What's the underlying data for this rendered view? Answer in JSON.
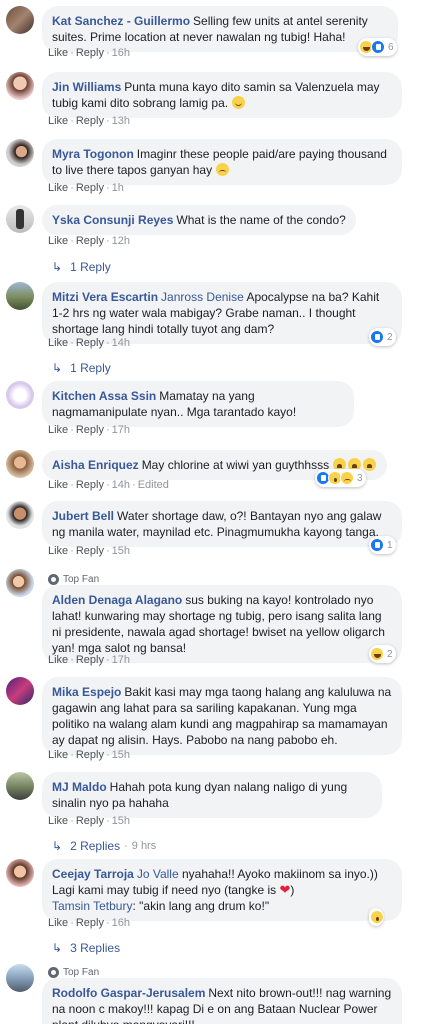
{
  "actions": {
    "like": "Like",
    "reply": "Reply",
    "edited": "Edited",
    "dot": "·"
  },
  "comments": [
    {
      "name": "Kat Sanchez - Guillermo",
      "text": "Selling few units at antel serenity suites. Prime location at never nawalan ng tubig! Haha!",
      "time": "16h",
      "reactions": [
        "haha",
        "like"
      ],
      "reaction_count": "6",
      "avatar_icon": "profile-photo"
    },
    {
      "name": "Jin Williams",
      "text": "Punta muna kayo dito samin sa Valenzuela may tubig kami dito sobrang lamig pa.",
      "emoji": "smile",
      "time": "13h",
      "avatar_icon": "profile-photo"
    },
    {
      "name": "Myra Togonon",
      "text": "Imaginr these people paid/are paying thousand to live there tapos ganyan hay",
      "emoji": "sad",
      "time": "1h",
      "avatar_icon": "profile-photo"
    },
    {
      "name": "Yska Consunji Reyes",
      "text": "What is the name of the condo?",
      "time": "12h",
      "replies": "1 Reply",
      "avatar_icon": "profile-photo"
    },
    {
      "name": "Mitzi Vera Escartin",
      "mention": "Janross Denise",
      "text": "Apocalypse na ba? Kahit 1-2 hrs ng water wala mabigay? Grabe naman.. I thought shortage lang hindi totally tuyot ang dam?",
      "time": "14h",
      "reactions": [
        "like"
      ],
      "reaction_count": "2",
      "replies": "1 Reply",
      "avatar_icon": "profile-photo"
    },
    {
      "name": "Kitchen Assa Ssin",
      "text": "Mamatay na yang nagmamanipulate nyan.. Mga tarantado kayo!",
      "time": "17h",
      "avatar_icon": "profile-photo"
    },
    {
      "name": "Aisha Enriquez",
      "text": "May chlorine at wiwi yan guythhsss",
      "emojis": [
        "cry",
        "cry",
        "cry"
      ],
      "time": "14h",
      "edited": true,
      "reactions": [
        "like",
        "wow",
        "sad"
      ],
      "reaction_count": "3",
      "avatar_icon": "profile-photo"
    },
    {
      "name": "Jubert Bell",
      "text": "Water shortage daw, o?! Bantayan nyo ang galaw ng manila water, maynilad etc. Pinagmumukha kayong tanga.",
      "time": "15h",
      "reactions": [
        "like"
      ],
      "reaction_count": "1",
      "avatar_icon": "profile-photo"
    },
    {
      "name": "Alden Denaga Alagano",
      "badge": "Top Fan",
      "text": "sus buking na kayo! kontrolado nyo lahat! kunwaring may shortage ng tubig, pero isang salita lang ni presidente, nawala agad shortage! bwiset na yellow oligarch yan! mga salot ng bansa!",
      "time": "17h",
      "reactions": [
        "haha"
      ],
      "reaction_count": "2",
      "avatar_icon": "profile-photo"
    },
    {
      "name": "Mika Espejo",
      "text": "Bakit kasi may mga taong halang ang kaluluwa na gagawin ang lahat para sa sariling kapakanan. Yung mga politiko na walang alam kundi ang magpahirap sa mamamayan ay dapat ng alisin. Hays. Pabobo na nang pabobo eh.",
      "time": "15h",
      "avatar_icon": "profile-photo"
    },
    {
      "name": "MJ Maldo",
      "text": "Hahah pota kung dyan nalang naligo di yung sinalin nyo pa hahaha",
      "time": "15h",
      "replies": "2 Replies",
      "replies_sub": "9 hrs",
      "avatar_icon": "profile-photo"
    },
    {
      "name": "Ceejay Tarroja",
      "mention": "Jo Valle",
      "text": "nyahaha!! Ayoko makiinom sa inyo.)) Lagi kami may tubig if need nyo (tangke is",
      "text_after": ")",
      "second_mention": "Tamsin Tetbury",
      "second_text": ": \"akin lang ang drum ko!\"",
      "time": "16h",
      "reactions": [
        "wow"
      ],
      "reaction_count": "",
      "replies": "3 Replies",
      "avatar_icon": "profile-photo"
    },
    {
      "name": "Rodolfo Gaspar-Jerusalem",
      "badge": "Top Fan",
      "text": "Next nito brown-out!!! nag warning na noon c makoy!!! kapag Di e on ang Bataan Nuclear Power plant dilubyo mangyayari!!!",
      "avatar_icon": "profile-photo"
    }
  ]
}
